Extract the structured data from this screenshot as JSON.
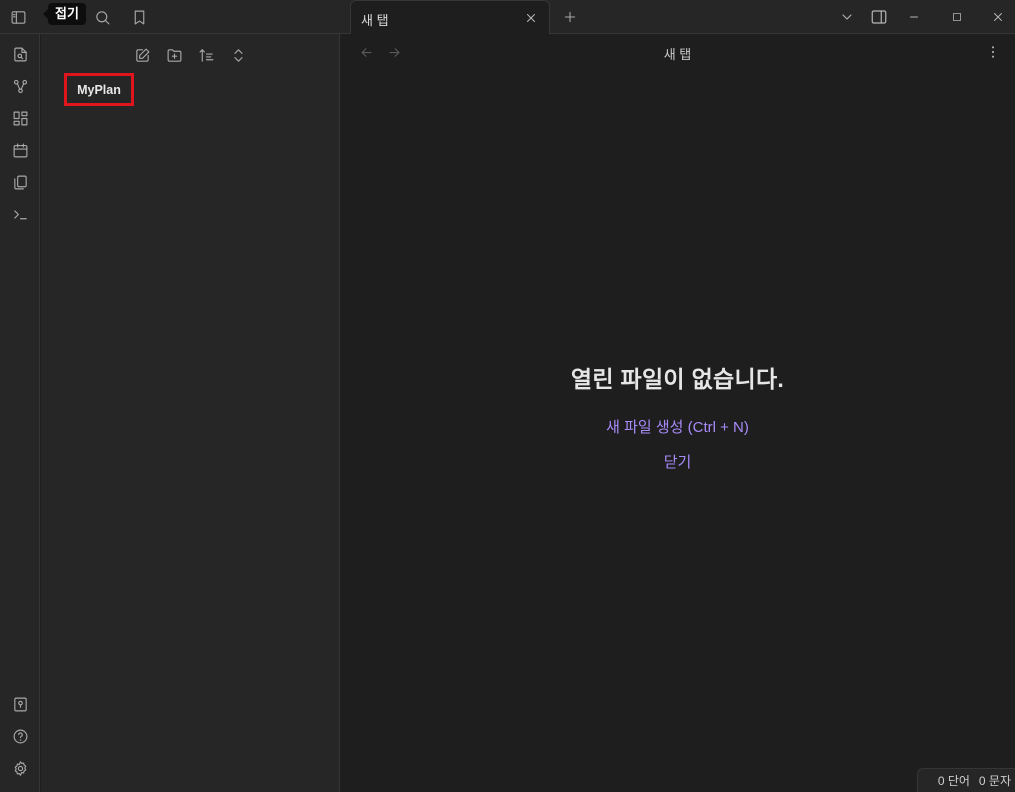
{
  "topbar": {
    "tooltip": "접기",
    "icons": [
      "sidebar-toggle-icon",
      "folder-icon",
      "search-icon",
      "bookmark-icon"
    ]
  },
  "ribbon": {
    "top_icons": [
      "quick-switcher-icon",
      "graph-view-icon",
      "canvas-icon",
      "daily-note-icon",
      "templates-icon",
      "command-palette-icon"
    ],
    "bottom_icons": [
      "vault-switcher-icon",
      "help-icon",
      "settings-icon"
    ]
  },
  "explorer": {
    "actions": [
      "new-note-icon",
      "new-folder-icon",
      "sort-icon",
      "collapse-all-icon"
    ],
    "items": [
      {
        "label": "MyPlan"
      }
    ]
  },
  "tabs": [
    {
      "title": "새 탭",
      "active": true
    }
  ],
  "view": {
    "title": "새 탭"
  },
  "empty_state": {
    "title": "열린 파일이 없습니다.",
    "new_file": "새 파일 생성 (Ctrl + N)",
    "close": "닫기"
  },
  "status": {
    "words": "0 단어",
    "chars": "0 문자"
  },
  "colors": {
    "background": "#1e1e1e",
    "panel": "#262626",
    "accent": "#a88bfa",
    "highlight_box": "#e0141c"
  }
}
